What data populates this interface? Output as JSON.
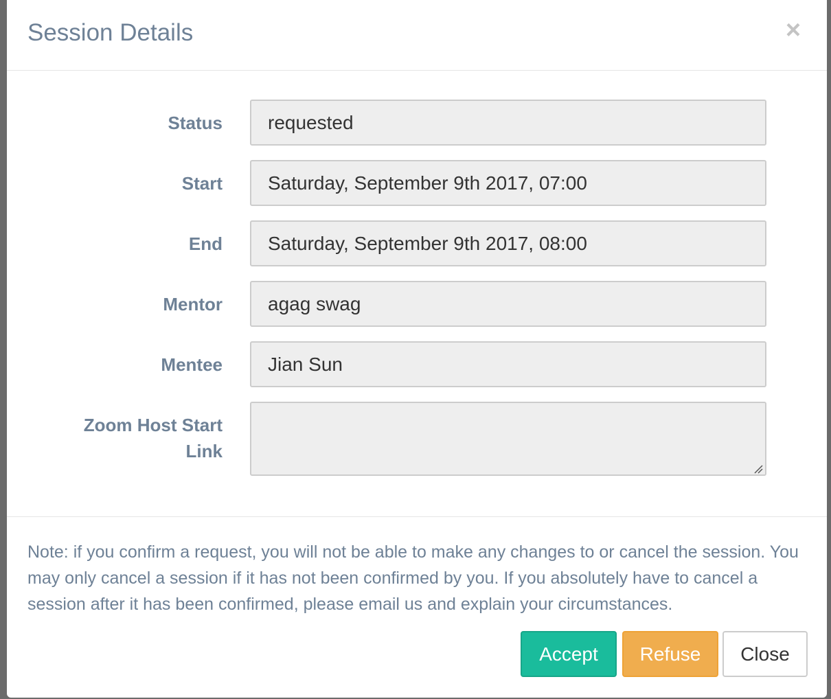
{
  "modal": {
    "title": "Session Details",
    "close_glyph": "×"
  },
  "fields": {
    "status": {
      "label": "Status",
      "value": "requested"
    },
    "start": {
      "label": "Start",
      "value": "Saturday, September 9th 2017, 07:00"
    },
    "end": {
      "label": "End",
      "value": "Saturday, September 9th 2017, 08:00"
    },
    "mentor": {
      "label": "Mentor",
      "value": "agag swag"
    },
    "mentee": {
      "label": "Mentee",
      "value": "Jian Sun"
    },
    "zoom": {
      "label_line1": "Zoom Host Start",
      "label_line2": "Link",
      "value": ""
    }
  },
  "footer": {
    "note": "Note: if you confirm a request, you will not be able to make any changes to or cancel the session. You may only cancel a session if it has not been confirmed by you. If you absolutely have to cancel a session after it has been confirmed, please email us and explain your circumstances.",
    "accept_label": "Accept",
    "refuse_label": "Refuse",
    "close_label": "Close"
  },
  "colors": {
    "title": "#6e8196",
    "accept": "#1abc9c",
    "refuse": "#f0ad4e",
    "field_bg": "#eeeeee"
  },
  "icons": {
    "close": "close-icon",
    "resize": "resize-grip-icon"
  }
}
